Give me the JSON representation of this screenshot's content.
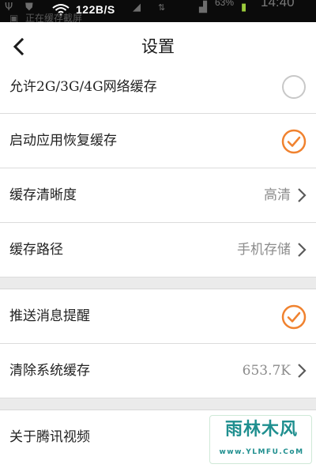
{
  "status_bar": {
    "net_speed": "122B/S",
    "battery_text": "63%",
    "time": "14:40",
    "notification_text": "正在缓存截屏"
  },
  "header": {
    "title": "设置",
    "back_icon": "chevron-left-icon"
  },
  "settings": {
    "network_cache": {
      "label": "允许2G/3G/4G网络缓存",
      "checked": false
    },
    "restore_cache": {
      "label": "启动应用恢复缓存",
      "checked": true
    },
    "clarity": {
      "label": "缓存清晰度",
      "value": "高清"
    },
    "path": {
      "label": "缓存路径",
      "value": "手机存储"
    },
    "push": {
      "label": "推送消息提醒",
      "checked": true
    },
    "clear_cache": {
      "label": "清除系统缓存",
      "value": "653.7K"
    },
    "about": {
      "label": "关于腾讯视频"
    }
  },
  "watermark": {
    "logo_text": "雨林木风",
    "url_text": "www.YLMFU.CoM"
  },
  "colors": {
    "accent_blue": "#2aa9e9",
    "check_orange": "#f0822f",
    "unchecked_gray": "#c8c8c8",
    "value_gray": "#8c8c8c"
  }
}
